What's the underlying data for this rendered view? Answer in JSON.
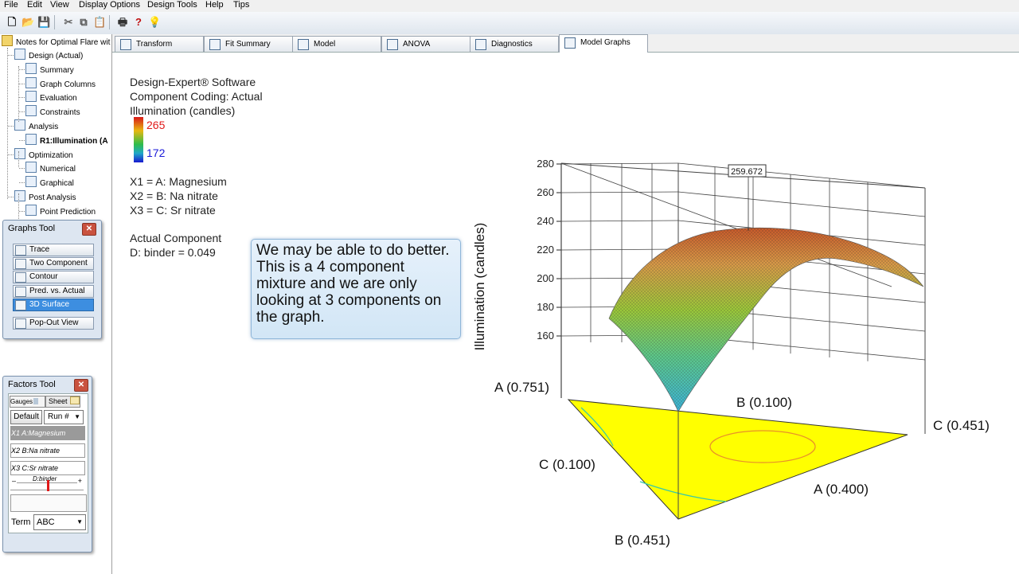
{
  "menu": [
    "File",
    "Edit",
    "View",
    "Display Options",
    "Design Tools",
    "Help",
    "Tips"
  ],
  "tree": {
    "root": "Notes for Optimal Flare wit",
    "items": [
      {
        "label": "Design (Actual)",
        "level": 1
      },
      {
        "label": "Summary",
        "level": 2
      },
      {
        "label": "Graph Columns",
        "level": 2
      },
      {
        "label": "Evaluation",
        "level": 2
      },
      {
        "label": "Constraints",
        "level": 2
      },
      {
        "label": "Analysis",
        "level": 1
      },
      {
        "label": "R1:Illumination (A",
        "level": 2,
        "bold": true
      },
      {
        "label": "Optimization",
        "level": 1
      },
      {
        "label": "Numerical",
        "level": 2
      },
      {
        "label": "Graphical",
        "level": 2
      },
      {
        "label": "Post Analysis",
        "level": 1
      },
      {
        "label": "Point Prediction",
        "level": 2
      }
    ]
  },
  "graphs_tool": {
    "title": "Graphs Tool",
    "buttons": [
      "Trace",
      "Two Component",
      "Contour",
      "Pred. vs. Actual",
      "3D Surface",
      "Pop-Out View"
    ],
    "active": "3D Surface"
  },
  "factors_tool": {
    "title": "Factors Tool",
    "tab_gauges": "Gauges",
    "tab_sheet": "Sheet",
    "default_button": "Default",
    "run_select": "Run #",
    "factors": [
      {
        "id": "X1",
        "name": "A:Magnesium",
        "selected": true
      },
      {
        "id": "X2",
        "name": "B:Na nitrate",
        "selected": false
      },
      {
        "id": "X3",
        "name": "C:Sr nitrate",
        "selected": false
      }
    ],
    "slider_label": "D:binder",
    "slider_minus": "–",
    "slider_plus": "+",
    "slider_value": 0.5,
    "term_label": "Term",
    "term_value": "ABC"
  },
  "tabs": [
    "Transform",
    "Fit Summary",
    "Model",
    "ANOVA",
    "Diagnostics",
    "Model Graphs"
  ],
  "active_tab": "Model Graphs",
  "graph_info": {
    "software": "Design-Expert® Software",
    "coding": "Component Coding: Actual",
    "response": "Illumination (candles)",
    "scale_max": "265",
    "scale_min": "172",
    "x1": "X1 = A: Magnesium",
    "x2": "X2 = B: Na nitrate",
    "x3": "X3 = C: Sr nitrate",
    "actual_component": "Actual Component",
    "binder": "D: binder = 0.049"
  },
  "note": "We may be able to do better.  This is a 4 component mixture and we are only looking at 3 components on the graph.",
  "chart_data": {
    "type": "3d-surface",
    "zlabel": "Illumination (candles)",
    "z_ticks": [
      "160",
      "180",
      "200",
      "220",
      "240",
      "260",
      "280"
    ],
    "zlim": [
      160,
      280
    ],
    "max_flag": "259.672",
    "vertex_labels": [
      "A (0.751)",
      "B (0.100)",
      "C (0.451)",
      "C (0.100)",
      "A (0.400)",
      "B (0.451)"
    ],
    "color_scale": {
      "min": 172,
      "max": 265
    },
    "base_color": "#ffff00"
  }
}
